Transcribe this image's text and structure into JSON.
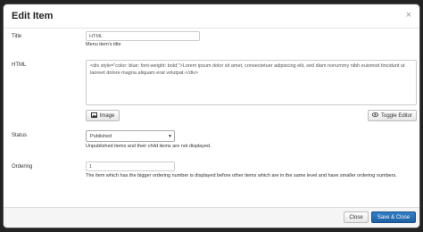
{
  "dialog": {
    "title": "Edit Item",
    "close_glyph": "×"
  },
  "title_field": {
    "label": "Title",
    "value": "HTML",
    "help": "Menu item's title"
  },
  "html_field": {
    "label": "HTML",
    "value": "<div style=\"color: blue; font-weight: bold;\">Lorem ipsum dolor sit amet, consectetuer adipiscing elit, sed diam nonummy nibh euismod tincidunt ut laoreet dolore magna aliquam erat volutpat.</div>",
    "image_button": "Image",
    "toggle_editor_button": "Toggle Editor"
  },
  "status_field": {
    "label": "Status",
    "selected": "Published",
    "help": "Unpublished items and their child items are not displayed."
  },
  "ordering_field": {
    "label": "Ordering",
    "value": "1",
    "help": "The item which has the bigger ordering number is displayed before other items which are in the same level and have smaller ordering numbers."
  },
  "footer": {
    "close_button": "Close",
    "save_close_button": "Save & Close"
  },
  "icons": {
    "image": "image-icon",
    "toggle": "eye-icon",
    "select": "chevron-down-icon"
  },
  "colors": {
    "primary": "#2a6fb8",
    "backdrop": "#232323"
  }
}
